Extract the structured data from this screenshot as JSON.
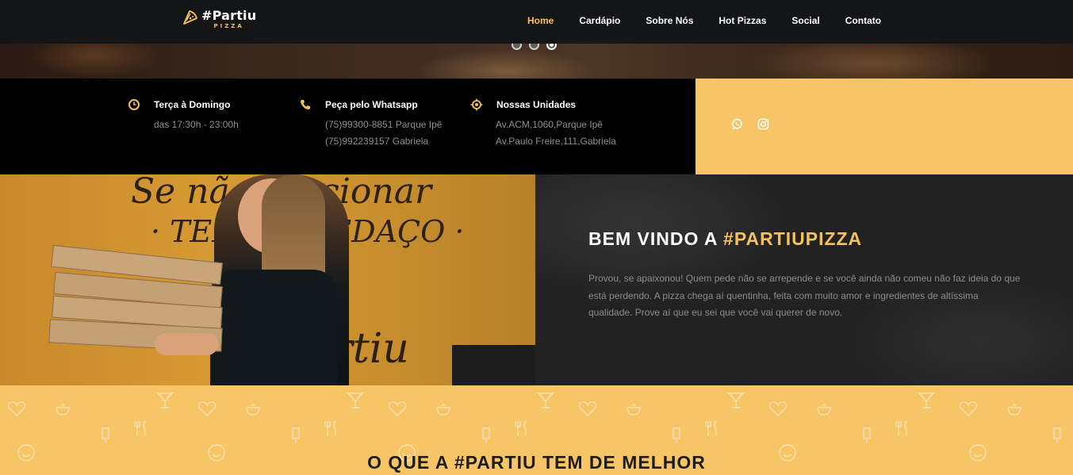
{
  "brand": {
    "title": "#Partiu",
    "subtitle": "PIZZA",
    "accent_color": "#f6c05a"
  },
  "nav": {
    "items": [
      {
        "label": "Home",
        "active": true
      },
      {
        "label": "Cardápio",
        "active": false
      },
      {
        "label": "Sobre Nós",
        "active": false
      },
      {
        "label": "Hot Pizzas",
        "active": false
      },
      {
        "label": "Social",
        "active": false
      },
      {
        "label": "Contato",
        "active": false
      }
    ]
  },
  "slider": {
    "slide_count": 3,
    "active_index": 2
  },
  "info": {
    "hours": {
      "icon": "clock-icon",
      "title": "Terça à Domingo",
      "lines": [
        "das 17:30h - 23:00h"
      ]
    },
    "whatsapp": {
      "icon": "phone-icon",
      "title": "Peça pelo Whatsapp",
      "lines": [
        "(75)99300-8851 Parque Ipê",
        "(75)992239157 Gabriela"
      ]
    },
    "units": {
      "icon": "location-icon",
      "title": "Nossas Unidades",
      "lines": [
        "Av.ACM,1060,Parque Ipê",
        "Av.Paulo Freire,111,Gabriela"
      ]
    }
  },
  "social": {
    "icons": [
      "whatsapp-icon",
      "instagram-icon"
    ]
  },
  "welcome": {
    "title_prefix": "BEM VINDO A ",
    "title_accent": "#PARTIUPIZZA",
    "text": "Provou, se apaixonou! Quem pede não se arrepende e se você ainda não comeu não faz ideia do que está perdendo. A pizza chega aí quentinha, feita com muito amor e ingredientes de altíssima qualidade. Prove aí que eu sei que você vai querer de novo."
  },
  "best": {
    "title": "O QUE A #PARTIU TEM DE MELHOR"
  },
  "colors": {
    "navbar": "#141517",
    "yellow": "#f8c566",
    "chalkboard": "#222222",
    "muted_text": "#8c8c8c"
  }
}
